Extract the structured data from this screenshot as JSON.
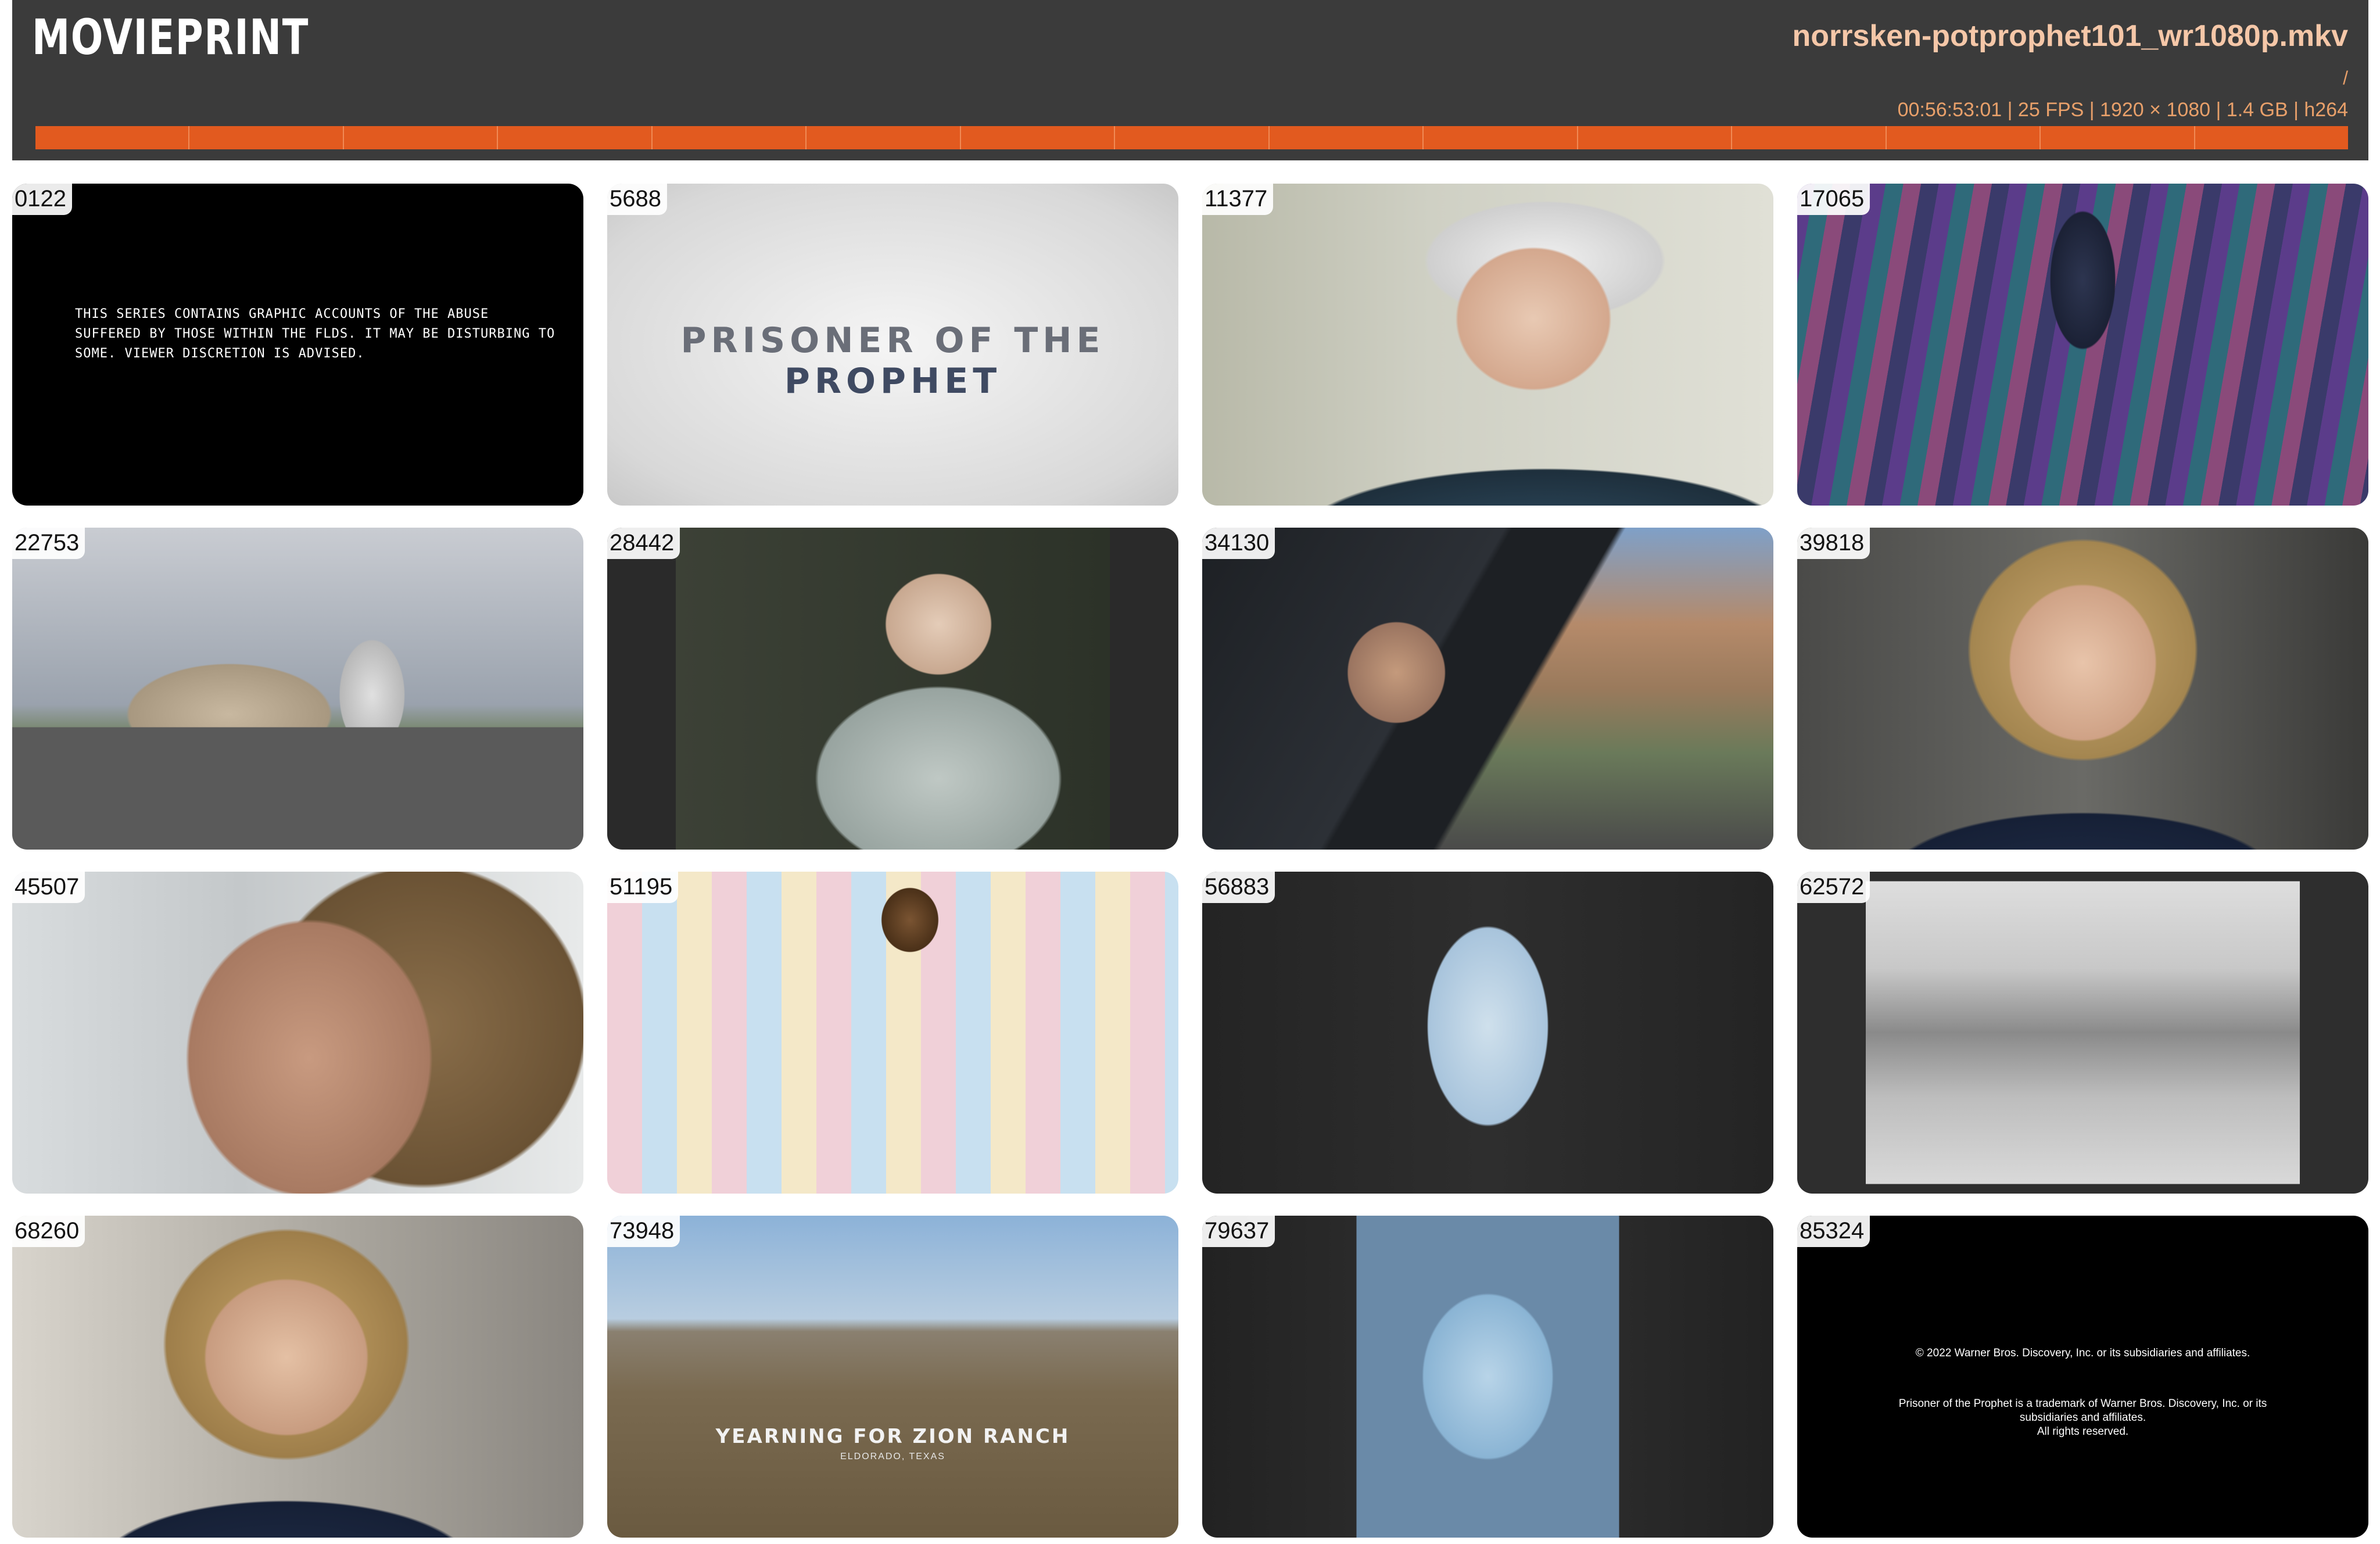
{
  "app": {
    "logo": "MOVIEPRINT"
  },
  "file": {
    "name": "norrsken-potprophet101_wr1080p.mkv",
    "path": "/",
    "info": "00:56:53:01 | 25 FPS | 1920 × 1080 | 1.4 GB | h264"
  },
  "timeline": {
    "segments": 15,
    "accent": "#e25a1f"
  },
  "thumbs": [
    {
      "frame": "0122",
      "scene": "content-warning-card"
    },
    {
      "frame": "5688",
      "scene": "title-card"
    },
    {
      "frame": "11377",
      "scene": "elderly-woman-portrait"
    },
    {
      "frame": "17065",
      "scene": "crowd-archive-footage"
    },
    {
      "frame": "22753",
      "scene": "building-street"
    },
    {
      "frame": "28442",
      "scene": "elderly-man-photo"
    },
    {
      "frame": "34130",
      "scene": "man-driving"
    },
    {
      "frame": "39818",
      "scene": "woman-interview"
    },
    {
      "frame": "45507",
      "scene": "woman-profile"
    },
    {
      "frame": "51195",
      "scene": "group-photo"
    },
    {
      "frame": "56883",
      "scene": "man-portrait-wall"
    },
    {
      "frame": "62572",
      "scene": "bw-ranch-photo"
    },
    {
      "frame": "68260",
      "scene": "woman-interview"
    },
    {
      "frame": "73948",
      "scene": "desert-landscape"
    },
    {
      "frame": "79637",
      "scene": "couple-photo-wall"
    },
    {
      "frame": "85324",
      "scene": "credits-card"
    }
  ],
  "cards": {
    "warning_lines": [
      "THIS SERIES CONTAINS GRAPHIC ACCOUNTS OF THE ABUSE",
      "SUFFERED BY THOSE WITHIN THE FLDS. IT MAY BE DISTURBING TO",
      "SOME. VIEWER DISCRETION IS ADVISED."
    ],
    "title_part1": "PRISONER OF THE ",
    "title_part2": "PROPHET",
    "ranch_title": "YEARNING FOR ZION RANCH",
    "ranch_sub": "ELDORADO, TEXAS",
    "credits_line1": "© 2022 Warner Bros. Discovery, Inc. or its subsidiaries and affiliates.",
    "credits_line2": "Prisoner of the Prophet is a trademark of Warner Bros. Discovery, Inc. or its",
    "credits_line3": "subsidiaries and affiliates.",
    "credits_line4": "All rights reserved."
  }
}
